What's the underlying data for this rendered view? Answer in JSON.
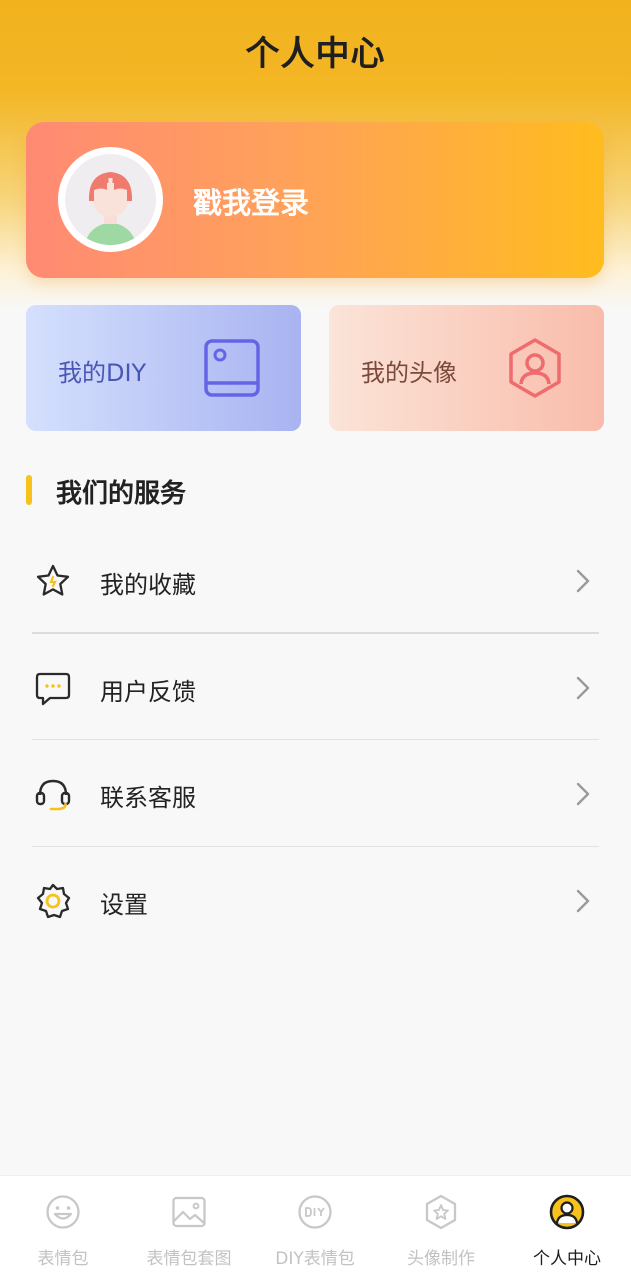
{
  "header": {
    "title": "个人中心"
  },
  "login": {
    "text": "戳我登录"
  },
  "quick_cards": [
    {
      "label": "我的DIY",
      "icon": "book-icon"
    },
    {
      "label": "我的头像",
      "icon": "hexagon-person-icon"
    }
  ],
  "services": {
    "title": "我们的服务",
    "items": [
      {
        "label": "我的收藏",
        "icon": "star-icon"
      },
      {
        "label": "用户反馈",
        "icon": "chat-bubble-icon"
      },
      {
        "label": "联系客服",
        "icon": "headset-icon"
      },
      {
        "label": "设置",
        "icon": "gear-icon"
      }
    ]
  },
  "tabbar": {
    "tabs": [
      {
        "label": "表情包",
        "icon": "smiley-icon",
        "active": false
      },
      {
        "label": "表情包套图",
        "icon": "image-icon",
        "active": false
      },
      {
        "label": "DIY表情包",
        "icon": "diy-icon",
        "active": false
      },
      {
        "label": "头像制作",
        "icon": "hexagon-star-icon",
        "active": false
      },
      {
        "label": "个人中心",
        "icon": "user-circle-icon",
        "active": true
      }
    ]
  },
  "colors": {
    "accent": "#f6c21b",
    "header_bg": "#f2b21e",
    "login_card_start": "#ff8a74",
    "login_card_end": "#ffbc1f",
    "inactive_tab": "#c2c2c2"
  }
}
